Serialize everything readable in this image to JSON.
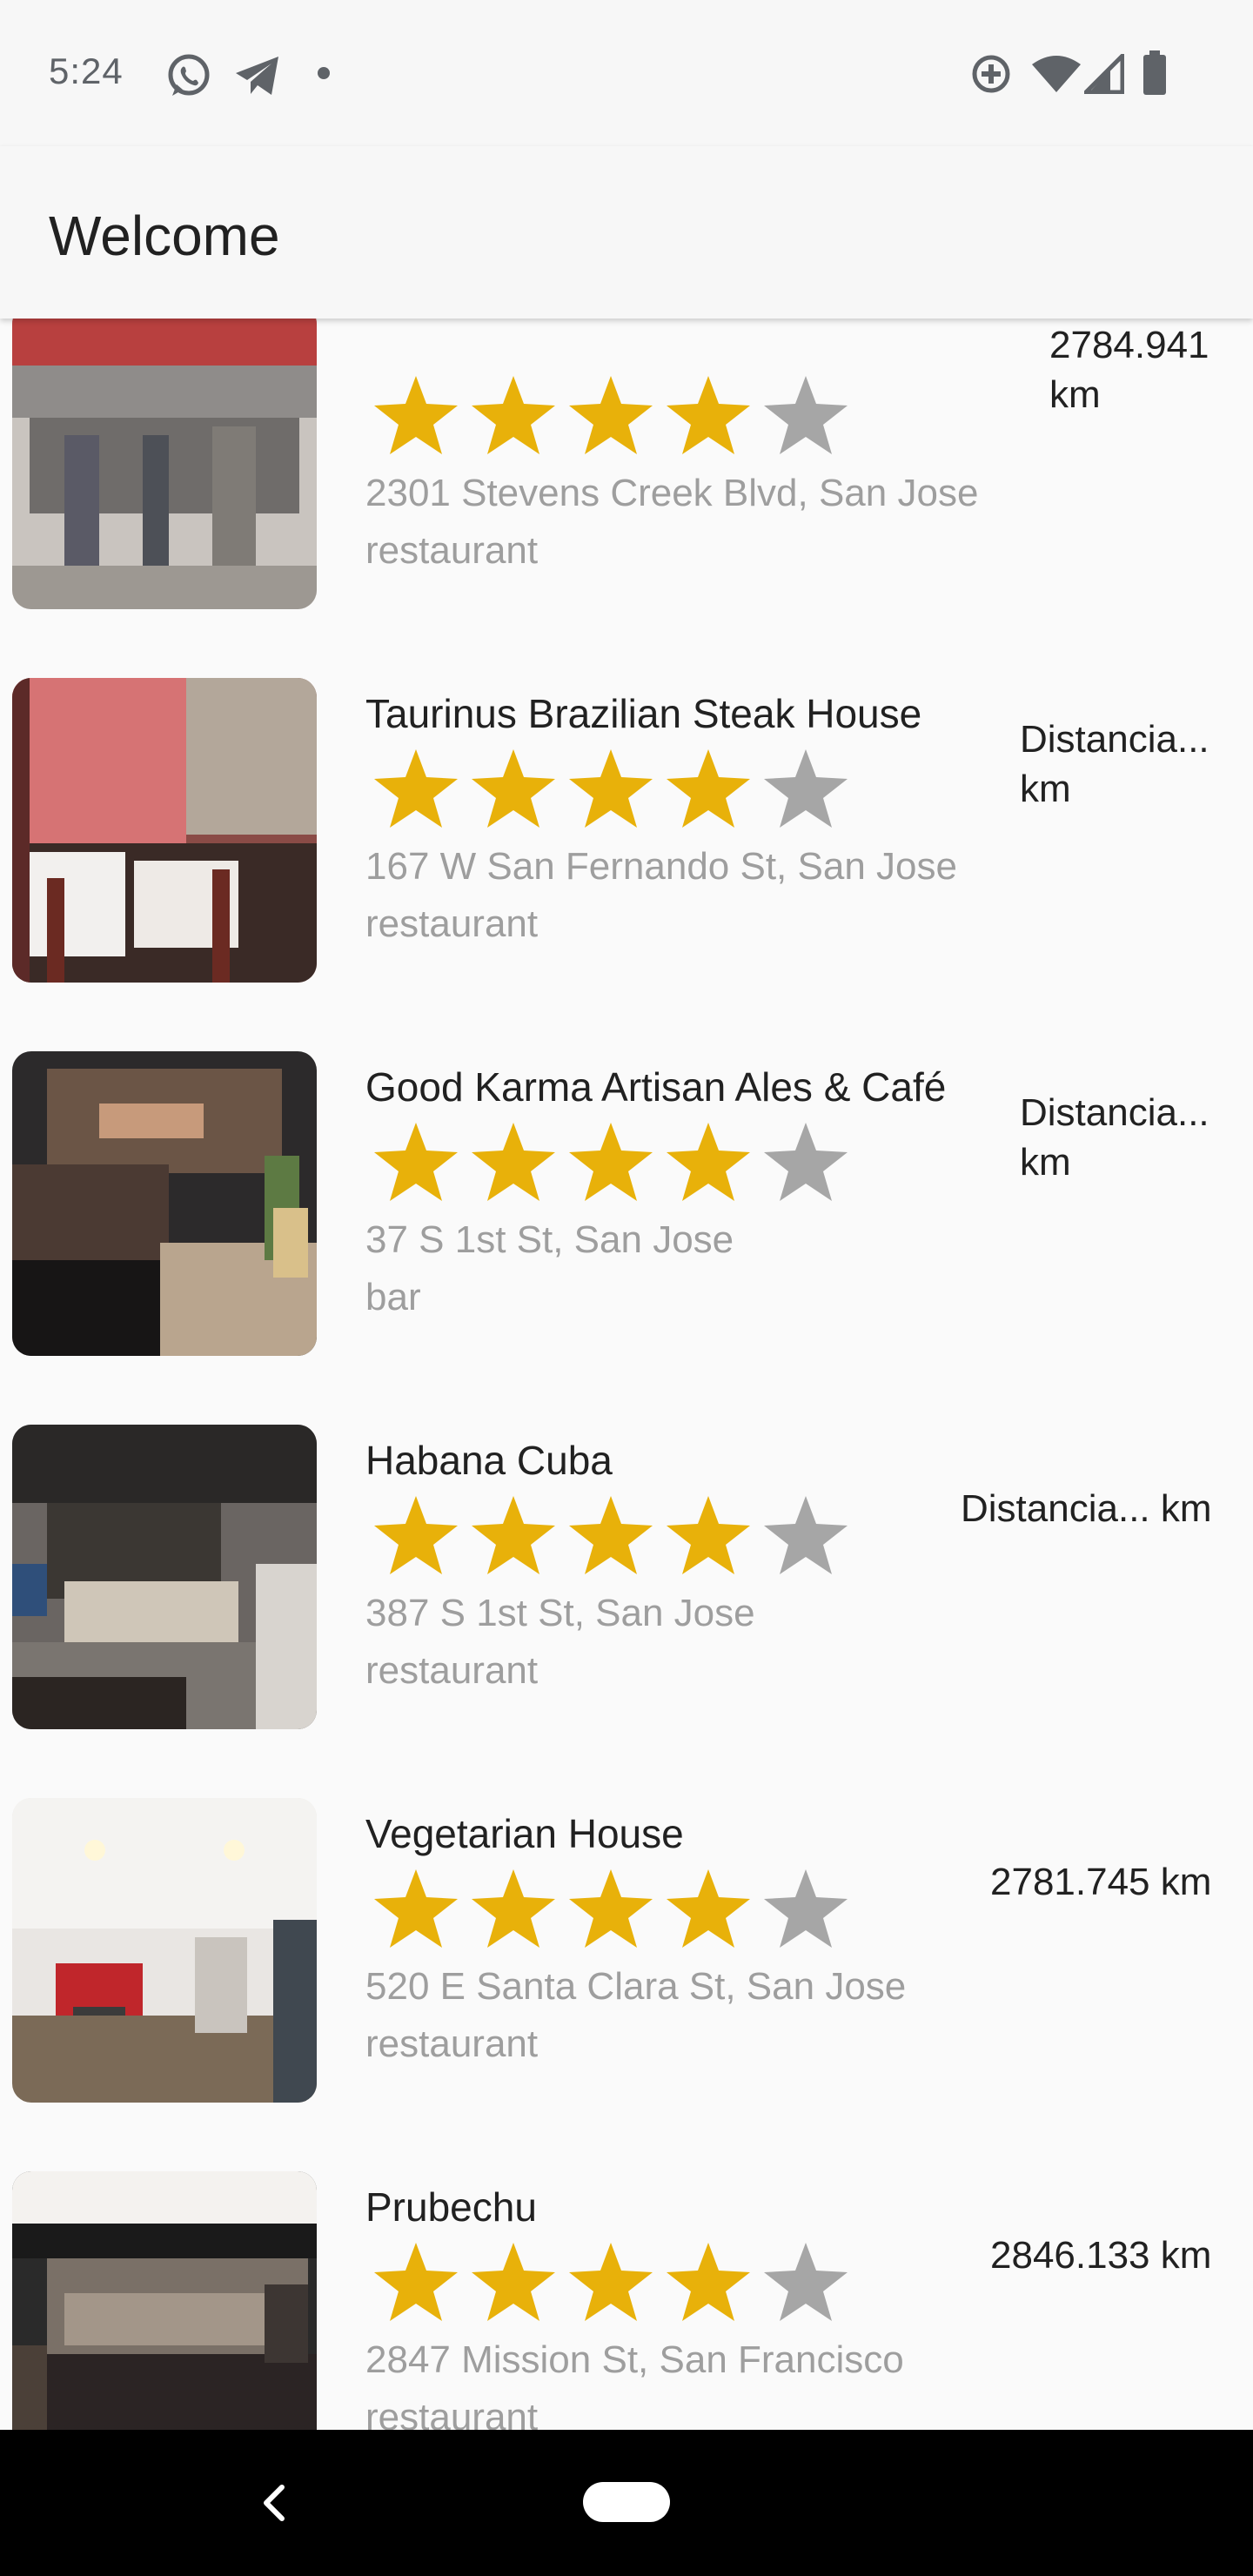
{
  "status_bar": {
    "time": "5:24",
    "icons_left": [
      "whatsapp-icon",
      "telegram-icon",
      "notification-dot-icon"
    ],
    "icons_right": [
      "data-saver-icon",
      "wifi-icon",
      "signal-icon",
      "battery-icon"
    ]
  },
  "app_bar": {
    "title": "Welcome"
  },
  "colors": {
    "star_filled": "#E8B10A",
    "star_empty": "#A6A6A6",
    "secondary_text": "#9E9E9E"
  },
  "places": [
    {
      "name": "",
      "rating": 4,
      "address": "2301 Stevens Creek Blvd, San Jose",
      "category": "restaurant",
      "distance_line1": "2784.941",
      "distance_line2": "km"
    },
    {
      "name": "Taurinus Brazilian Steak House",
      "rating": 4,
      "address": "167 W San Fernando St, San Jose",
      "category": "restaurant",
      "distance_line1": "Distancia...",
      "distance_line2": "km"
    },
    {
      "name": "Good Karma Artisan Ales & Café",
      "rating": 4,
      "address": "37 S 1st St, San Jose",
      "category": "bar",
      "distance_line1": "Distancia...",
      "distance_line2": "km"
    },
    {
      "name": "Habana Cuba",
      "rating": 4,
      "address": "387 S 1st St, San Jose",
      "category": "restaurant",
      "distance_line1": "Distancia... km",
      "distance_line2": ""
    },
    {
      "name": "Vegetarian House",
      "rating": 4,
      "address": "520 E Santa Clara St, San Jose",
      "category": "restaurant",
      "distance_line1": "2781.745 km",
      "distance_line2": ""
    },
    {
      "name": "Prubechu",
      "rating": 4,
      "address": "2847 Mission St, San Francisco",
      "category": "restaurant",
      "distance_line1": "2846.133 km",
      "distance_line2": ""
    }
  ],
  "nav_bar": {
    "icons": [
      "back-icon",
      "home-pill-icon"
    ]
  }
}
